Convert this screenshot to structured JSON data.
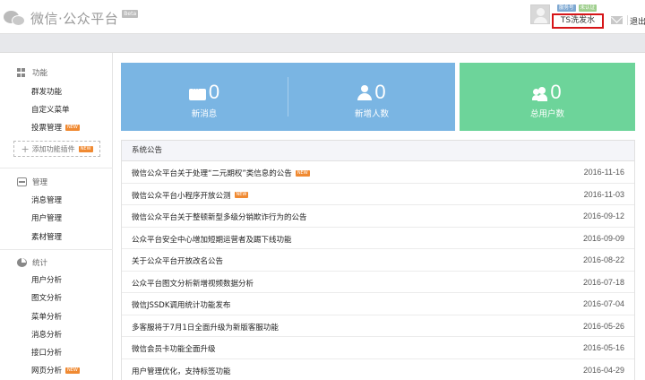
{
  "header": {
    "logo_text": "微信·公众平台",
    "beta": "Beta",
    "tags": [
      "服务号",
      "未认证"
    ],
    "account_name": "TS洗发水",
    "logout": "退出"
  },
  "sidebar": {
    "sections": [
      {
        "title": "功能",
        "icon": "grid-icon",
        "items": [
          {
            "label": "群发功能",
            "new": ""
          },
          {
            "label": "自定义菜单",
            "new": ""
          },
          {
            "label": "投票管理",
            "new": "NEW"
          }
        ]
      },
      {
        "title": "管理",
        "icon": "inbox-icon",
        "items": [
          {
            "label": "消息管理",
            "new": ""
          },
          {
            "label": "用户管理",
            "new": ""
          },
          {
            "label": "素材管理",
            "new": ""
          }
        ]
      },
      {
        "title": "统计",
        "icon": "pie-chart-icon",
        "items": [
          {
            "label": "用户分析",
            "new": ""
          },
          {
            "label": "图文分析",
            "new": ""
          },
          {
            "label": "菜单分析",
            "new": ""
          },
          {
            "label": "消息分析",
            "new": ""
          },
          {
            "label": "接口分析",
            "new": ""
          },
          {
            "label": "网页分析",
            "new": "NEW"
          }
        ]
      }
    ],
    "add_plugin": "添加功能插件",
    "add_plugin_tag": "NEW"
  },
  "stats": {
    "new_messages": {
      "value": "0",
      "label": "新消息",
      "icon": "message-icon"
    },
    "new_users": {
      "value": "0",
      "label": "新增人数",
      "icon": "person-icon"
    },
    "total_users": {
      "value": "0",
      "label": "总用户数",
      "icon": "people-icon"
    },
    "colors": {
      "blue": "#7ab5e3",
      "green": "#6dd49a"
    }
  },
  "notice": {
    "title": "系统公告",
    "rows": [
      {
        "title": "微信公众平台关于处理“二元期权”类信息的公告",
        "new": "NEW",
        "date": "2016-11-16"
      },
      {
        "title": "微信公众平台小程序开放公测",
        "new": "NEW",
        "date": "2016-11-03"
      },
      {
        "title": "微信公众平台关于整顿新型多级分销欺诈行为的公告",
        "new": "",
        "date": "2016-09-12"
      },
      {
        "title": "公众平台安全中心增加短期运营者及踢下线功能",
        "new": "",
        "date": "2016-09-09"
      },
      {
        "title": "关于公众平台开放改名公告",
        "new": "",
        "date": "2016-08-22"
      },
      {
        "title": "公众平台图文分析新增视频数据分析",
        "new": "",
        "date": "2016-07-18"
      },
      {
        "title": "微信JSSDK调用统计功能发布",
        "new": "",
        "date": "2016-07-04"
      },
      {
        "title": "多客服将于7月1日全面升级为新版客服功能",
        "new": "",
        "date": "2016-05-26"
      },
      {
        "title": "微信会员卡功能全面升级",
        "new": "",
        "date": "2016-05-16"
      },
      {
        "title": "用户管理优化，支持标签功能",
        "new": "",
        "date": "2016-04-29"
      }
    ]
  }
}
